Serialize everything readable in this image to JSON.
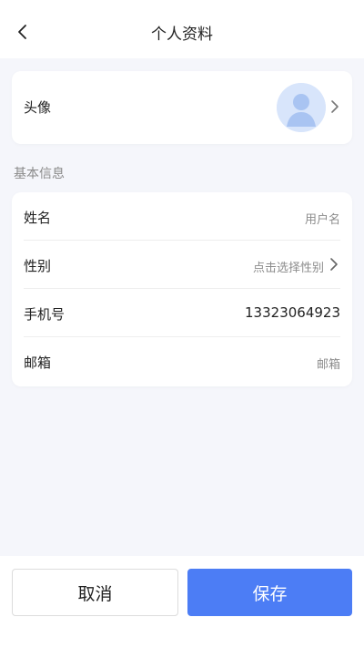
{
  "header": {
    "title": "个人资料",
    "back_icon": "chevron-left-icon"
  },
  "avatar_section": {
    "label": "头像",
    "avatar_icon": "default-user-avatar",
    "chevron_icon": "chevron-right-icon"
  },
  "basic_info": {
    "section_title": "基本信息",
    "rows": [
      {
        "label": "姓名",
        "value": "用户名",
        "value_type": "placeholder"
      },
      {
        "label": "性别",
        "value": "点击选择性别",
        "value_type": "placeholder",
        "chevron_icon": "chevron-right-icon"
      },
      {
        "label": "手机号",
        "value": "13323064923",
        "value_type": "value"
      },
      {
        "label": "邮箱",
        "value": "邮箱",
        "value_type": "placeholder"
      }
    ]
  },
  "footer": {
    "cancel_label": "取消",
    "save_label": "保存"
  },
  "colors": {
    "background": "#f5f6fb",
    "card": "#ffffff",
    "accent": "#4c7df5",
    "placeholder_text": "#8c8c8c",
    "avatar_bg": "#dbe7fb"
  }
}
